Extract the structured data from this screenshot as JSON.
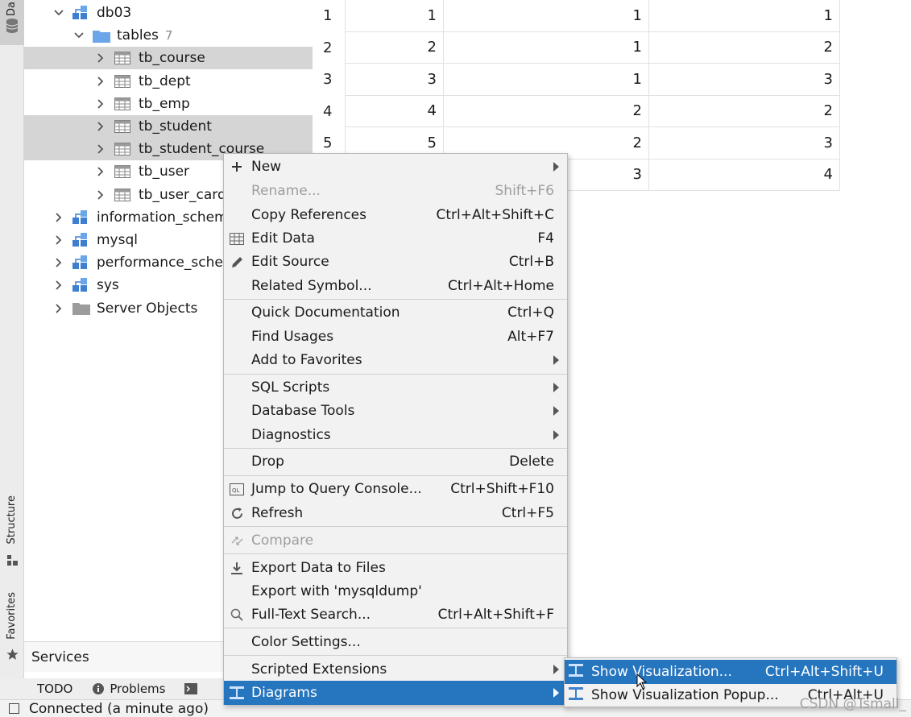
{
  "side_strip": {
    "top_label": "Da",
    "structure_label": "Structure",
    "favorites_label": "Favorites"
  },
  "tree": {
    "items": [
      {
        "label": "db03",
        "kind": "schema",
        "indent": 2,
        "expanded": true
      },
      {
        "label": "tables",
        "kind": "folder",
        "indent": 3,
        "expanded": true,
        "count": "7"
      },
      {
        "label": "tb_course",
        "kind": "table",
        "indent": 4,
        "selected": true
      },
      {
        "label": "tb_dept",
        "kind": "table",
        "indent": 4
      },
      {
        "label": "tb_emp",
        "kind": "table",
        "indent": 4
      },
      {
        "label": "tb_student",
        "kind": "table",
        "indent": 4,
        "selected": true
      },
      {
        "label": "tb_student_course",
        "kind": "table",
        "indent": 4,
        "selected": true
      },
      {
        "label": "tb_user",
        "kind": "table",
        "indent": 4
      },
      {
        "label": "tb_user_card",
        "kind": "table",
        "indent": 4
      },
      {
        "label": "information_schema",
        "kind": "schema",
        "indent": 1
      },
      {
        "label": "mysql",
        "kind": "schema",
        "indent": 1
      },
      {
        "label": "performance_schema",
        "kind": "schema",
        "indent": 1
      },
      {
        "label": "sys",
        "kind": "schema",
        "indent": 1
      },
      {
        "label": "Server Objects",
        "kind": "server",
        "indent": 1
      }
    ]
  },
  "grid": {
    "rows": [
      {
        "n": "1",
        "a": "1",
        "b": "1",
        "c": "1"
      },
      {
        "n": "2",
        "a": "2",
        "b": "1",
        "c": "2"
      },
      {
        "n": "3",
        "a": "3",
        "b": "1",
        "c": "3"
      },
      {
        "n": "4",
        "a": "4",
        "b": "2",
        "c": "2"
      },
      {
        "n": "5",
        "a": "5",
        "b": "2",
        "c": "3"
      },
      {
        "n": "",
        "a": "",
        "b": "3",
        "c": "4"
      }
    ]
  },
  "services_label": "Services",
  "bottom_tabs": {
    "todo": "TODO",
    "problems": "Problems"
  },
  "status_text": "Connected (a minute ago)",
  "context_menu": {
    "new": {
      "label": "New"
    },
    "rename": {
      "label": "Rename...",
      "shortcut": "Shift+F6"
    },
    "copy_refs": {
      "label": "Copy References",
      "shortcut": "Ctrl+Alt+Shift+C"
    },
    "edit_data": {
      "label": "Edit Data",
      "shortcut": "F4"
    },
    "edit_source": {
      "label": "Edit Source",
      "shortcut": "Ctrl+B"
    },
    "related_symbol": {
      "label": "Related Symbol...",
      "shortcut": "Ctrl+Alt+Home"
    },
    "quick_doc": {
      "label": "Quick Documentation",
      "shortcut": "Ctrl+Q"
    },
    "find_usages": {
      "label": "Find Usages",
      "shortcut": "Alt+F7"
    },
    "add_favorites": {
      "label": "Add to Favorites"
    },
    "sql_scripts": {
      "label": "SQL Scripts"
    },
    "database_tools": {
      "label": "Database Tools"
    },
    "diagnostics": {
      "label": "Diagnostics"
    },
    "drop": {
      "label": "Drop",
      "shortcut": "Delete"
    },
    "jump_console": {
      "label": "Jump to Query Console...",
      "shortcut": "Ctrl+Shift+F10"
    },
    "refresh": {
      "label": "Refresh",
      "shortcut": "Ctrl+F5"
    },
    "compare": {
      "label": "Compare"
    },
    "export_files": {
      "label": "Export Data to Files"
    },
    "export_mysqldump": {
      "label": "Export with 'mysqldump'"
    },
    "fulltext": {
      "label": "Full-Text Search...",
      "shortcut": "Ctrl+Alt+Shift+F"
    },
    "color_settings": {
      "label": "Color Settings..."
    },
    "scripted_ext": {
      "label": "Scripted Extensions"
    },
    "diagrams": {
      "label": "Diagrams"
    }
  },
  "submenu": {
    "show_vis": {
      "label": "Show Visualization...",
      "shortcut": "Ctrl+Alt+Shift+U"
    },
    "show_vis_popup": {
      "label": "Show Visualization Popup...",
      "shortcut": "Ctrl+Alt+U"
    }
  },
  "watermark": "CSDN @Tsmall_",
  "colors": {
    "selection": "#2675bf",
    "schema_icon": "#3f7fd0",
    "folder_icon": "#6ba6e8"
  }
}
